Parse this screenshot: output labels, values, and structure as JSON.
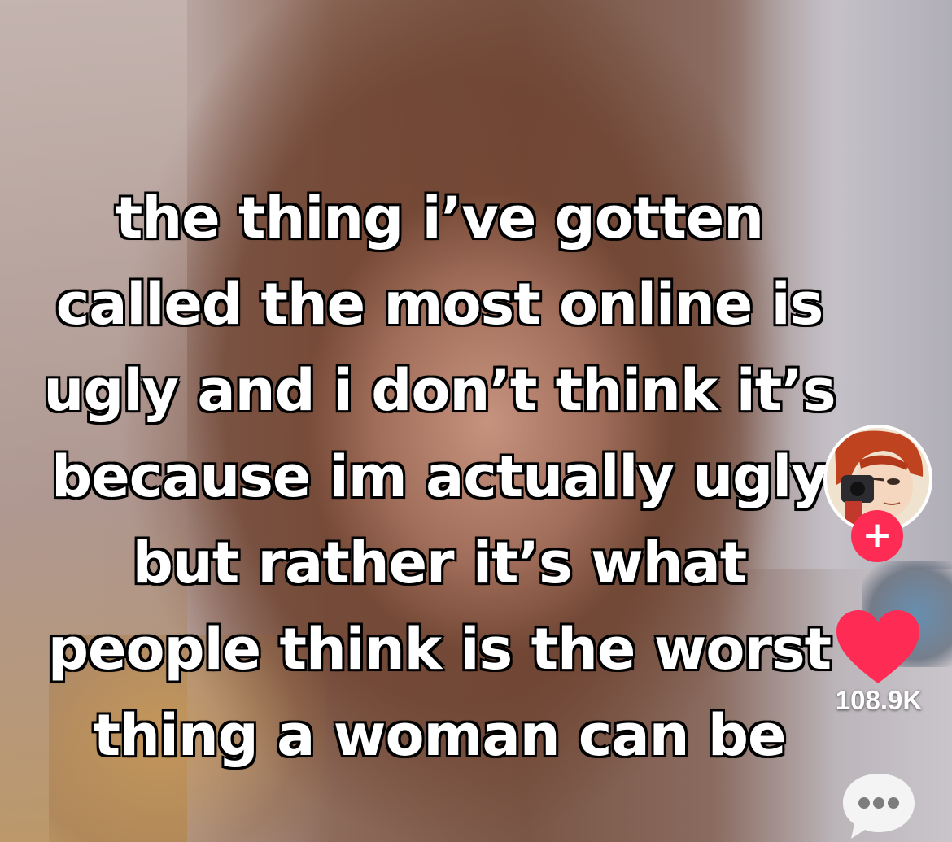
{
  "caption": {
    "lines": [
      "the thing i’ve gotten",
      "called the most online is",
      "ugly and i don’t think it’s",
      "because im actually ugly",
      "but rather it’s what",
      "people think is the worst",
      "thing a woman can be"
    ]
  },
  "rail": {
    "avatar_icon": "profile-avatar",
    "follow_label": "+",
    "like_icon": "heart-icon",
    "like_count": "108.9K",
    "comment_icon": "comment-bubble-icon"
  },
  "colors": {
    "accent": "#fe2c55",
    "caption_text": "#ffffff",
    "caption_stroke": "#000000"
  }
}
